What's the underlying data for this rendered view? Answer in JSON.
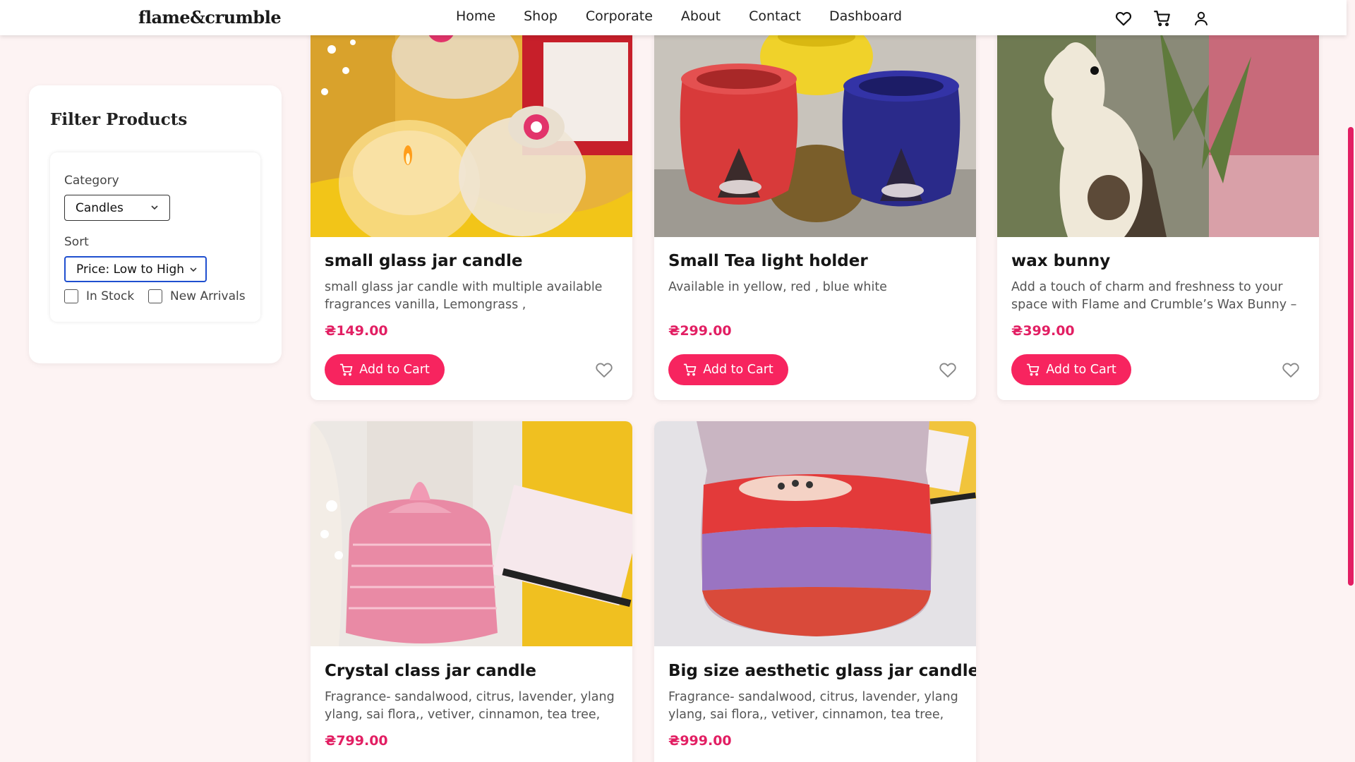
{
  "header": {
    "logo": "flame&crumble",
    "nav": [
      "Home",
      "Shop",
      "Corporate",
      "About",
      "Contact",
      "Dashboard"
    ],
    "icons": [
      "heart-icon",
      "cart-icon",
      "user-icon"
    ]
  },
  "filter": {
    "title": "Filter Products",
    "category_label": "Category",
    "category_value": "Candles",
    "sort_label": "Sort",
    "sort_value": "Price: Low to High",
    "in_stock_label": "In Stock",
    "new_arrivals_label": "New Arrivals"
  },
  "products": [
    {
      "title": "small glass jar candle",
      "desc": "small glass jar candle with multiple available fragrances vanilla, Lemongrass ,",
      "price": "₴149.00",
      "button": "Add to Cart"
    },
    {
      "title": "Small Tea light holder",
      "desc": "Available in yellow, red , blue white",
      "price": "₴299.00",
      "button": "Add to Cart"
    },
    {
      "title": "wax bunny",
      "desc": "Add a touch of charm and freshness to your space with Flame and Crumble’s Wax Bunny –",
      "price": "₴399.00",
      "button": "Add to Cart"
    },
    {
      "title": "Crystal class jar candle",
      "desc": "Fragrance- sandalwood, citrus, lavender, ylang ylang, sai flora,, vetiver, cinnamon, tea tree,",
      "price": "₴799.00"
    },
    {
      "title": "Big size aesthetic glass jar candles",
      "desc": "Fragrance- sandalwood, citrus, lavender, ylang ylang, sai flora,, vetiver, cinnamon, tea tree,",
      "price": "₴999.00"
    }
  ],
  "colors": {
    "accent": "#e21f63",
    "button": "#f7245f",
    "page_bg": "#fdf3f3"
  }
}
